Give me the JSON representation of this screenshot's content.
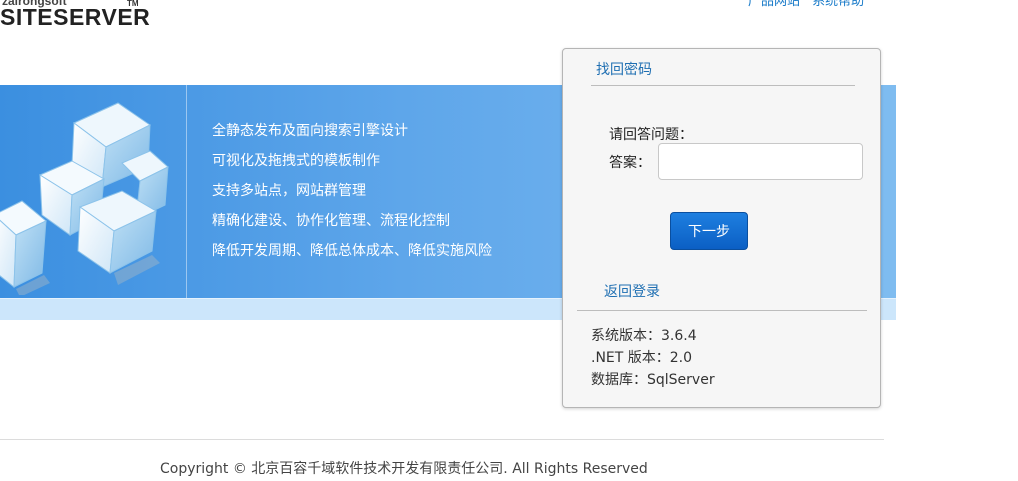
{
  "logo": {
    "small": "zairongsoft",
    "main": "SITESERVER",
    "tm": "TM"
  },
  "top_links": [
    "产品网站",
    "系统帮助"
  ],
  "banner": {
    "features": [
      "全静态发布及面向搜索引擎设计",
      "可视化及拖拽式的模板制作",
      "支持多站点，网站群管理",
      "精确化建设、协作化管理、流程化控制",
      "降低开发周期、降低总体成本、降低实施风险"
    ]
  },
  "panel": {
    "title": "找回密码",
    "question_label": "请回答问题：",
    "answer_label": "答案：",
    "answer_value": "",
    "next_button": "下一步",
    "back_link": "返回登录",
    "info": [
      "系统版本：3.6.4",
      ".NET 版本：2.0",
      "数据库：SqlServer"
    ]
  },
  "footer": {
    "copyright": "Copyright © 北京百容千域软件技术开发有限责任公司. All Rights Reserved"
  },
  "colors": {
    "accent": "#1f6fb2",
    "banner": "#5ea6ea",
    "button": "#1470d6"
  }
}
